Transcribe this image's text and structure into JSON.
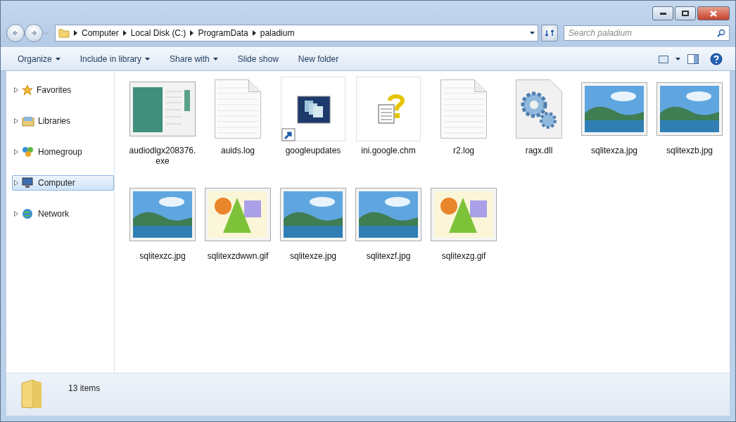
{
  "address": {
    "crumbs": [
      "Computer",
      "Local Disk (C:)",
      "ProgramData",
      "paladium"
    ]
  },
  "search": {
    "placeholder": "Search paladium"
  },
  "toolbar": {
    "items": [
      {
        "label": "Organize",
        "dropdown": true
      },
      {
        "label": "Include in library",
        "dropdown": true
      },
      {
        "label": "Share with",
        "dropdown": true
      },
      {
        "label": "Slide show",
        "dropdown": false
      },
      {
        "label": "New folder",
        "dropdown": false
      }
    ]
  },
  "sidebar": {
    "items": [
      {
        "label": "Favorites",
        "kind": "favorites",
        "selected": false
      },
      {
        "label": "Libraries",
        "kind": "libraries",
        "selected": false
      },
      {
        "label": "Homegroup",
        "kind": "homegroup",
        "selected": false
      },
      {
        "label": "Computer",
        "kind": "computer",
        "selected": true
      },
      {
        "label": "Network",
        "kind": "network",
        "selected": false
      }
    ]
  },
  "files": [
    {
      "name": "audiodlgx208376.exe",
      "kind": "exe"
    },
    {
      "name": "auids.log",
      "kind": "text"
    },
    {
      "name": "googleupdates",
      "kind": "shortcut"
    },
    {
      "name": "ini.google.chm",
      "kind": "help"
    },
    {
      "name": "r2.log",
      "kind": "text"
    },
    {
      "name": "ragx.dll",
      "kind": "dll"
    },
    {
      "name": "sqlitexza.jpg",
      "kind": "photo"
    },
    {
      "name": "sqlitexzb.jpg",
      "kind": "photo"
    },
    {
      "name": "sqlitexzc.jpg",
      "kind": "photo"
    },
    {
      "name": "sqlitexzdwwn.gif",
      "kind": "shapes"
    },
    {
      "name": "sqlitexze.jpg",
      "kind": "photo"
    },
    {
      "name": "sqlitexzf.jpg",
      "kind": "photo"
    },
    {
      "name": "sqlitexzg.gif",
      "kind": "shapes"
    }
  ],
  "status_bar": {
    "count": "13 items"
  }
}
